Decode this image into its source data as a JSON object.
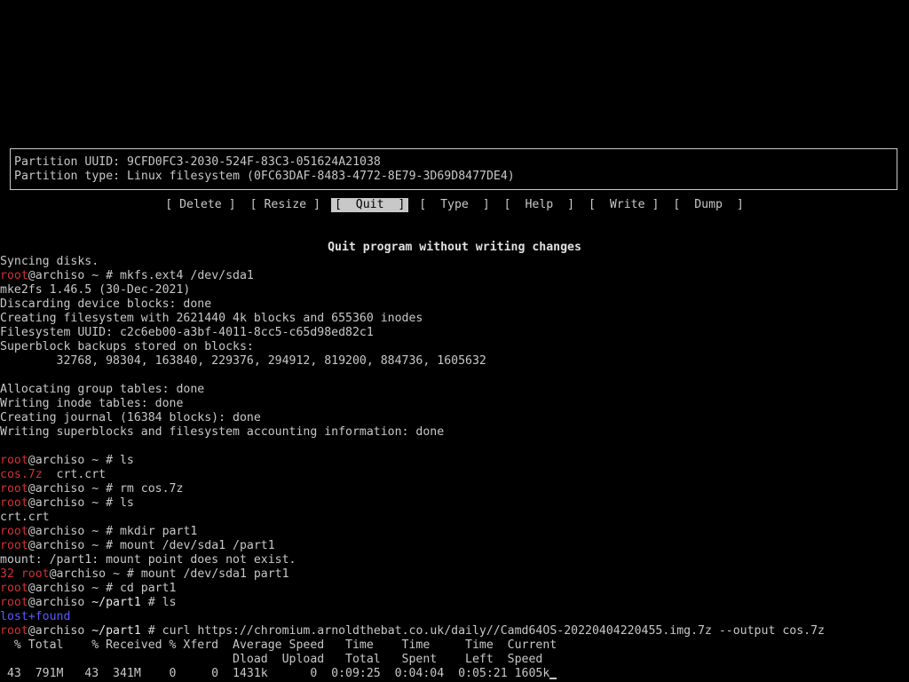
{
  "colors": {
    "background": "#000000",
    "text": "#c8c8c8",
    "prompt_user": "#d23232",
    "directory": "#5a5aff"
  },
  "partition_info": {
    "uuid_line": "Partition UUID: 9CFD0FC3-2030-524F-83C3-051624A21038",
    "type_line": "Partition type: Linux filesystem (0FC63DAF-8483-4772-8E79-3D69D8477DE4)"
  },
  "menu": {
    "delete": "[ Delete ]",
    "resize": "[ Resize ]",
    "quit": "[  Quit  ]",
    "type": "[  Type  ]",
    "help": "[  Help  ]",
    "write": "[  Write ]",
    "dump": "[  Dump  ]",
    "selected": "quit"
  },
  "status_text": "Quit program without writing changes",
  "prompt": {
    "user": "root",
    "host_home": "@archiso ~ # ",
    "host_part": "@archiso ",
    "part_path": "~/part1",
    "part_suffix": " # ",
    "error_code": "32 "
  },
  "terminal": {
    "l01": "Syncing disks.",
    "c02": "mkfs.ext4 /dev/sda1",
    "l03": "mke2fs 1.46.5 (30-Dec-2021)",
    "l04": "Discarding device blocks: done",
    "l05": "Creating filesystem with 2621440 4k blocks and 655360 inodes",
    "l06": "Filesystem UUID: c2c6eb00-a3bf-4011-8cc5-c65d98ed82c1",
    "l07": "Superblock backups stored on blocks:",
    "l08": "        32768, 98304, 163840, 229376, 294912, 819200, 884736, 1605632",
    "l10": "Allocating group tables: done",
    "l11": "Writing inode tables: done",
    "l12": "Creating journal (16384 blocks): done",
    "l13": "Writing superblocks and filesystem accounting information: done",
    "c15": "ls",
    "l16_file1": "cos.7z",
    "l16_file2": "  crt.crt",
    "c17": "rm cos.7z",
    "c18": "ls",
    "l19": "crt.crt",
    "c20": "mkdir part1",
    "c21": "mount /dev/sda1 /part1",
    "l22": "mount: /part1: mount point does not exist.",
    "c23": "mount /dev/sda1 part1",
    "c24": "cd part1",
    "c25": "ls",
    "l26": "lost+found",
    "c27": "curl https://chromium.arnoldthebat.co.uk/daily//Camd64OS-20220404220455.img.7z --output cos.7z",
    "l28": "  % Total    % Received % Xferd  Average Speed   Time    Time     Time  Current",
    "l29": "                                 Dload  Upload   Total   Spent    Left  Speed",
    "l30": " 43  791M   43  341M    0     0  1431k      0  0:09:25  0:04:04  0:05:21 1605k"
  }
}
